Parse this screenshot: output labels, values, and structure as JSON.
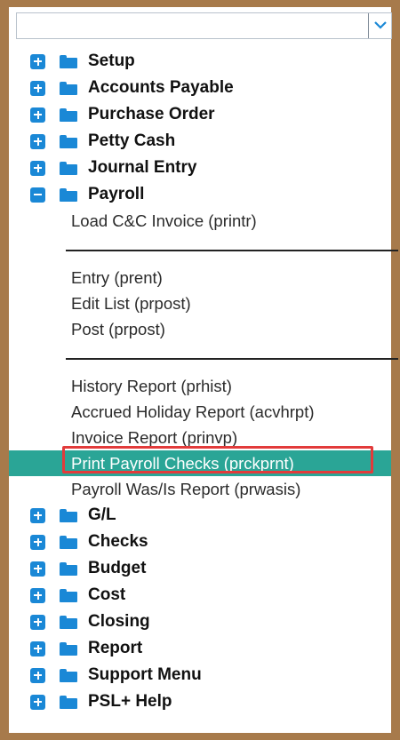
{
  "dropdown": {
    "value": "",
    "icon": "chevron-down-icon"
  },
  "folders_top": [
    {
      "label": "Setup",
      "state": "collapsed"
    },
    {
      "label": "Accounts Payable",
      "state": "collapsed"
    },
    {
      "label": "Purchase Order",
      "state": "collapsed"
    },
    {
      "label": "Petty Cash",
      "state": "collapsed"
    },
    {
      "label": "Journal Entry",
      "state": "collapsed"
    }
  ],
  "payroll": {
    "label": "Payroll",
    "state": "expanded",
    "group1": [
      "Load C&C Invoice (printr)"
    ],
    "group2": [
      "Entry (prent)",
      "Edit List (prpost)",
      "Post (prpost)"
    ],
    "group3": [
      "History Report (prhist)",
      "Accrued Holiday Report (acvhrpt)",
      "Invoice Report (prinvp)",
      "Print Payroll Checks (prckprnt)",
      "Payroll Was/Is Report (prwasis)"
    ],
    "selected_item": "Print Payroll Checks (prckprnt)"
  },
  "folders_bottom": [
    {
      "label": "G/L",
      "state": "collapsed"
    },
    {
      "label": "Checks",
      "state": "collapsed"
    },
    {
      "label": "Budget",
      "state": "collapsed"
    },
    {
      "label": "Cost",
      "state": "collapsed"
    },
    {
      "label": "Closing",
      "state": "collapsed"
    },
    {
      "label": "Report",
      "state": "collapsed"
    },
    {
      "label": "Support Menu",
      "state": "collapsed"
    },
    {
      "label": "PSL+ Help",
      "state": "collapsed"
    }
  ],
  "colors": {
    "frame": "#a77a4b",
    "icon_blue": "#1a88d6",
    "selection_teal": "#2aa596",
    "annotation_red": "#e23b3b"
  }
}
